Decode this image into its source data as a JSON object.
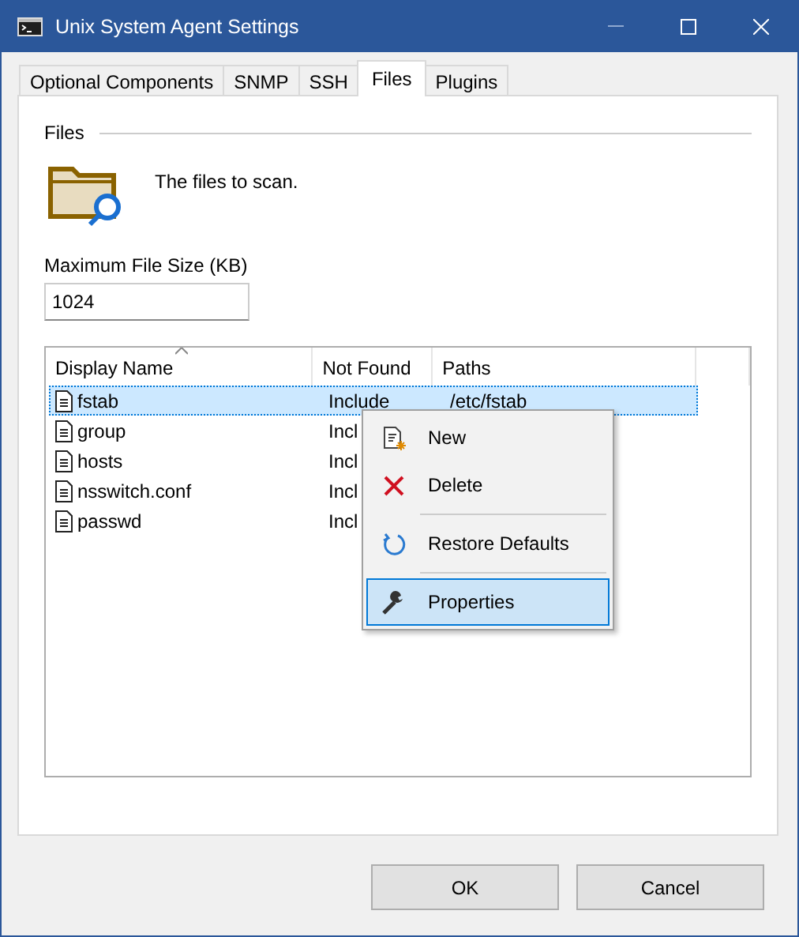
{
  "window": {
    "title": "Unix System Agent Settings"
  },
  "tabs": [
    {
      "label": "Optional Components",
      "selected": false
    },
    {
      "label": "SNMP",
      "selected": false
    },
    {
      "label": "SSH",
      "selected": false
    },
    {
      "label": "Files",
      "selected": true
    },
    {
      "label": "Plugins",
      "selected": false
    }
  ],
  "group": {
    "title": "Files",
    "description": "The files to scan."
  },
  "max_size": {
    "label": "Maximum File Size (KB)",
    "value": "1024"
  },
  "table": {
    "columns": [
      "Display Name",
      "Not Found",
      "Paths"
    ],
    "rows": [
      {
        "name": "fstab",
        "not_found": "Include",
        "path": "/etc/fstab",
        "selected": true
      },
      {
        "name": "group",
        "not_found": "Incl",
        "selected": false
      },
      {
        "name": "hosts",
        "not_found": "Incl",
        "selected": false
      },
      {
        "name": "nsswitch.conf",
        "not_found": "Incl",
        "selected": false
      },
      {
        "name": "passwd",
        "not_found": "Incl",
        "selected": false
      }
    ]
  },
  "context_menu": [
    {
      "kind": "new",
      "label": "New",
      "selected": false
    },
    {
      "kind": "delete",
      "label": "Delete",
      "selected": false
    },
    {
      "kind": "separator"
    },
    {
      "kind": "restore",
      "label": "Restore Defaults",
      "selected": false
    },
    {
      "kind": "separator"
    },
    {
      "kind": "properties",
      "label": "Properties",
      "selected": true
    }
  ],
  "buttons": [
    "OK",
    "Cancel"
  ]
}
